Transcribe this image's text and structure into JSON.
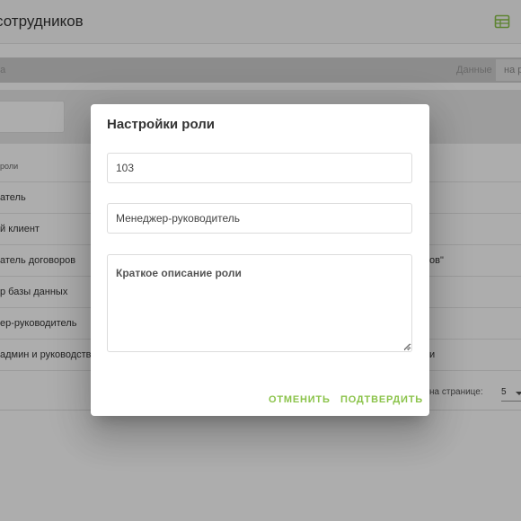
{
  "app": {
    "title": "ва сотрудников",
    "header_icon": "table-icon"
  },
  "toolbar": {
    "left_text": "ра",
    "right_text": "Данные",
    "chip_text": "на р"
  },
  "table": {
    "header": "роли",
    "rows": [
      {
        "role": "атель",
        "desc": ""
      },
      {
        "role": "й клиент",
        "desc": ""
      },
      {
        "role": "атель договоров",
        "desc": "ов\""
      },
      {
        "role": "р базы данных",
        "desc": ""
      },
      {
        "role": "ер-руководитель",
        "desc": ""
      },
      {
        "role": "админ и руководств",
        "desc": "и"
      }
    ]
  },
  "pagination": {
    "rows_per_page_label": "на странице:",
    "rows_per_page_value": "5"
  },
  "dialog": {
    "title": "Настройки роли",
    "role_id_value": "103",
    "role_name_value": "Менеджер-руководитель",
    "description_placeholder": "Краткое описание роли",
    "cancel_label": "ОТМЕНИТЬ",
    "confirm_label": "ПОДТВЕРДИТЬ",
    "accent_color": "#8bc34a"
  },
  "colors": {
    "overlay": "rgba(0,0,0,0.32)",
    "header_icon": "#8bc34a"
  }
}
